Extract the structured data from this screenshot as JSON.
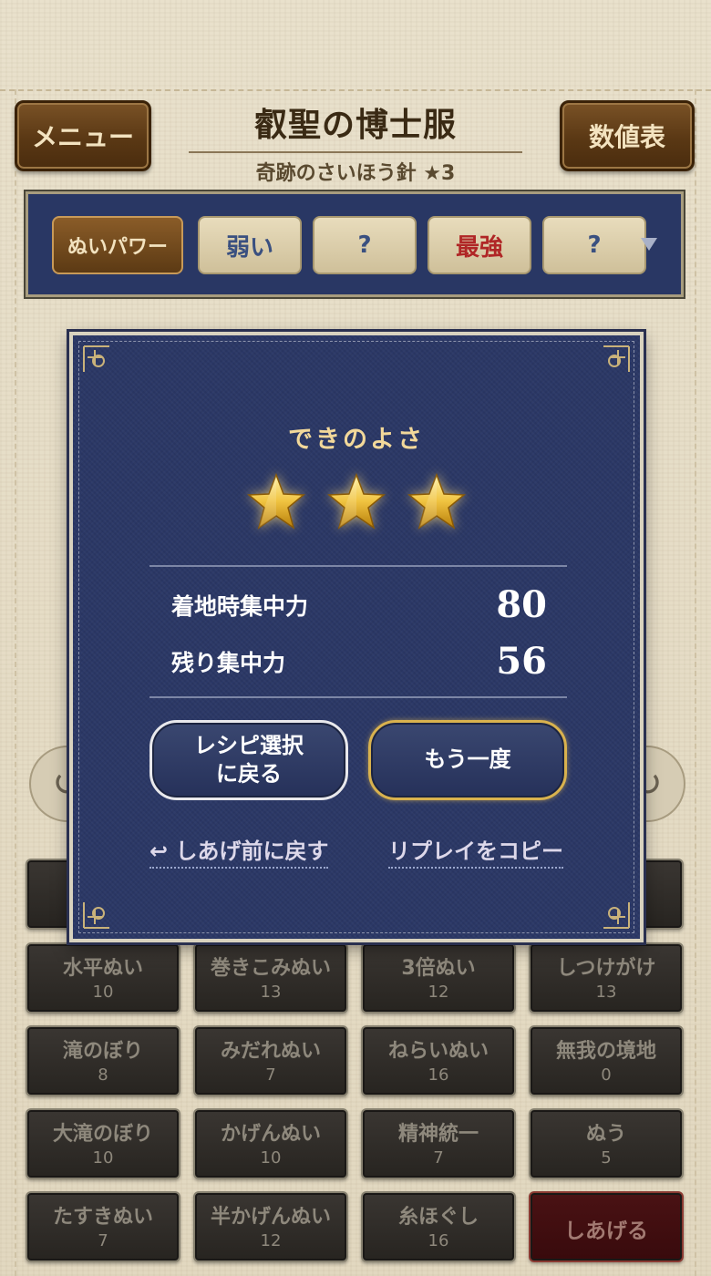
{
  "header": {
    "menu_label": "メニュー",
    "table_label": "数値表",
    "title": "叡聖の博士服",
    "subtitle": "奇跡のさいほう針 ★3"
  },
  "power_bar": {
    "main_label": "ぬいパワー",
    "cells": [
      {
        "label": "弱い",
        "color": "#3a5080"
      },
      {
        "label": "?",
        "color": "#3a5080"
      },
      {
        "label": "最強",
        "color": "#b02626"
      },
      {
        "label": "?",
        "color": "#3a5080"
      }
    ]
  },
  "modal": {
    "quality_label": "できのよさ",
    "stars_count": 3,
    "stats": [
      {
        "label": "着地時集中力",
        "value": "80"
      },
      {
        "label": "残り集中力",
        "value": "56"
      }
    ],
    "recipe_button": "レシピ選択\nに戻る",
    "retry_button": "もう一度",
    "undo_link": "↩ しあげ前に戻す",
    "copy_link": "リプレイをコピー"
  },
  "skills": [
    {
      "name": "水平ぬい",
      "count": "10"
    },
    {
      "name": "巻きこみぬい",
      "count": "13"
    },
    {
      "name": "3倍ぬい",
      "count": "12"
    },
    {
      "name": "しつけがけ",
      "count": "13"
    },
    {
      "name": "滝のぼり",
      "count": "8"
    },
    {
      "name": "みだれぬい",
      "count": "7"
    },
    {
      "name": "ねらいぬい",
      "count": "16"
    },
    {
      "name": "無我の境地",
      "count": "0"
    },
    {
      "name": "大滝のぼり",
      "count": "10"
    },
    {
      "name": "かげんぬい",
      "count": "10"
    },
    {
      "name": "精神統一",
      "count": "7"
    },
    {
      "name": "ぬう",
      "count": "5"
    },
    {
      "name": "たすきぬい",
      "count": "7"
    },
    {
      "name": "半かげんぬい",
      "count": "12"
    },
    {
      "name": "糸ほぐし",
      "count": "16"
    }
  ],
  "finish_button": "しあげる",
  "colors": {
    "modal_bg": "#2b3866",
    "gold_text": "#f2d89a",
    "wood": "#5a3814"
  }
}
